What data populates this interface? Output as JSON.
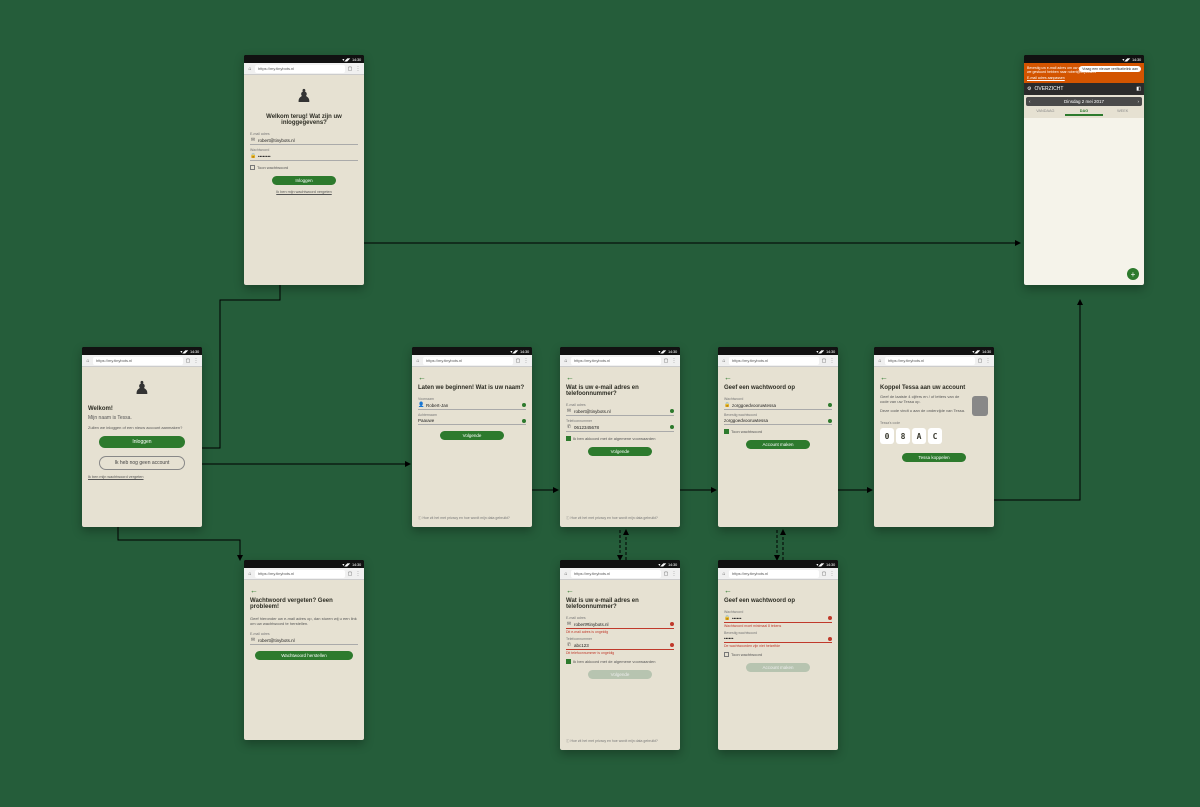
{
  "status": {
    "time": "14:30",
    "signal": "▾◢◤"
  },
  "chrome": {
    "url": "https://my.tinybots.nl"
  },
  "screens": {
    "welcome": {
      "title": "Welkom!",
      "subtitle": "Mijn naam is Tessa.",
      "prompt": "Zullen we inloggen of een nieuw account aanmaken?",
      "login_btn": "Inloggen",
      "noaccount_btn": "Ik heb nog geen account",
      "forgot_link": "Ik ben mijn wachtwoord vergeten"
    },
    "login": {
      "title": "Welkom terug! Wat zijn uw inloggegevens?",
      "email_label": "E-mail adres",
      "email": "robert@tinybots.nl",
      "pw_label": "Wachtwoord",
      "pw": "••••••••",
      "remember": "Toon wachtwoord",
      "btn": "Inloggen",
      "forgot_link": "Ik ben mijn wachtwoord vergeten"
    },
    "forgot": {
      "title": "Wachtwoord vergeten? Geen probleem!",
      "body": "Geef hieronder uw e-mail adres op, dan sturen wij u een link om uw wachtwoord te herstellen.",
      "email_label": "E-mail adres",
      "email": "robert@tinybots.nl",
      "btn": "Wachtwoord herstellen"
    },
    "name": {
      "title": "Laten we beginnen! Wat is uw naam?",
      "first_label": "Voornaam",
      "first": "Robert-Jan",
      "last_label": "Achternaam",
      "last": "Paauwe",
      "btn": "Volgende",
      "helper": "Hoe zit het met privacy en hoe wordt mijn data gebruikt?"
    },
    "email": {
      "title": "Wat is uw e-mail adres en telefoonnummer?",
      "email_label": "E-mail adres",
      "email": "robert@tinybots.nl",
      "phone_label": "Telefoonnummer",
      "phone": "0612345678",
      "agree": "Ik ben akkoord met de algemene voorwaarden",
      "btn": "Volgende",
      "helper": "Hoe zit het met privacy en hoe wordt mijn data gebruikt?"
    },
    "email_err": {
      "title": "Wat is uw e-mail adres en telefoonnummer?",
      "email_label": "E-mail adres",
      "email": "robert#tinybots.nl",
      "email_err": "Dit e-mail adres is ongeldig",
      "phone_label": "Telefoonnummer",
      "phone": "abc123",
      "phone_err": "Dit telefoonnummer is ongeldig",
      "agree": "Ik ben akkoord met de algemene voorwaarden",
      "btn": "Volgende",
      "helper": "Hoe zit het met privacy en hoe wordt mijn data gebruikt?"
    },
    "pw": {
      "title": "Geef een wachtwoord op",
      "pw_label": "Wachtwoord",
      "pw": "zorggoedvooruwtessa",
      "pw2_label": "Bevestig wachtwoord",
      "pw2": "zorggoedvooruwtessa",
      "show": "Toon wachtwoord",
      "btn": "Account maken"
    },
    "pw_err": {
      "title": "Geef een wachtwoord op",
      "pw_label": "Wachtwoord",
      "pw": "••••••",
      "pw_err": "Wachtwoord moet minimaal 8 tekens",
      "pw2_label": "Bevestig wachtwoord",
      "pw2": "••••••",
      "pw2_err": "De wachtwoorden zijn niet hetzelfde",
      "show": "Toon wachtwoord",
      "btn": "Account maken"
    },
    "pair": {
      "title": "Koppel Tessa aan uw account",
      "body": "Geef de laatste 4 cijfers en / of letters van de code van uw Tessa op.",
      "body2": "Deze code vindt u aan de onderzijde van Tessa.",
      "code_label": "Tessa's code",
      "code": [
        "0",
        "8",
        "A",
        "C"
      ],
      "btn": "Tessa koppelen"
    },
    "overview": {
      "banner": "Bevestig uw e-mail adres om uw account te activeren. Klik op de link die we gestuurd hebben naar robert@tinybots.nl",
      "banner_link": "E-mail adres aanpassen",
      "pill": "Vraag een nieuwe verificatielink aan",
      "header": "OVERZICHT",
      "date": "Dinsdag 2 mei 2017",
      "tabs": [
        "VANDAAG",
        "DAG",
        "WEEK"
      ]
    }
  }
}
